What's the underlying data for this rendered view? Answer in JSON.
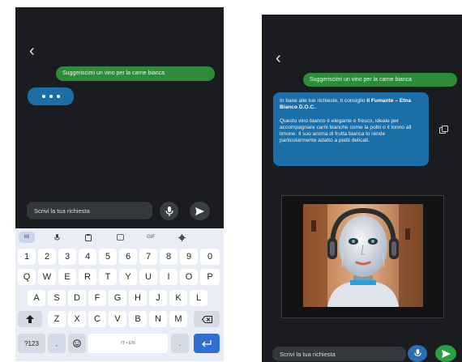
{
  "left_screen": {
    "back_glyph": "‹",
    "user_message": "Suggeriscimi un vino per la carne bianca",
    "input_placeholder": "Scrivi la tua richiesta",
    "keyboard": {
      "toolbar": [
        "88",
        "mic",
        "clipboard",
        "sticker",
        "GIF",
        "gear"
      ],
      "gif_label": "GIF",
      "apps_label": "88",
      "row_numbers": [
        "1",
        "2",
        "3",
        "4",
        "5",
        "6",
        "7",
        "8",
        "9",
        "0"
      ],
      "row_q": [
        "Q",
        "W",
        "E",
        "R",
        "T",
        "Y",
        "U",
        "I",
        "O",
        "P"
      ],
      "row_a": [
        "A",
        "S",
        "D",
        "F",
        "G",
        "H",
        "J",
        "K",
        "L"
      ],
      "row_z": [
        "Z",
        "X",
        "C",
        "V",
        "B",
        "N",
        "M"
      ],
      "symbols_label": "?123",
      "comma_label": ",",
      "space_label": "IT • EN",
      "period_label": "."
    }
  },
  "right_screen": {
    "back_glyph": "‹",
    "user_message": "Suggeriscimi un vino per la carne bianca",
    "bot_intro": "In base alle tue richieste, ti consiglio ",
    "bot_wine": "Il Fumante – Etna Bianco D.O.C.",
    "bot_intro_end": ".",
    "bot_body": "Questo vino bianco è elegante e fresco, ideale per accompagnare carni bianche come la pollo o il tonno all limone. Il suo aroma di frutta bianca lo rende particolarmente adatto a piatti delicati.",
    "input_placeholder": "Scrivi la tua richiesta"
  },
  "colors": {
    "screen_bg": "#1a1c1f",
    "user_bubble": "#2e8b3c",
    "bot_bubble": "#1c6ea8",
    "send_green": "#2e9e45",
    "keyboard_bg": "#e9eef6"
  },
  "icons": [
    "back-arrow-icon",
    "mic-icon",
    "send-icon",
    "copy-icon",
    "clipboard-icon",
    "sticker-icon",
    "gear-icon",
    "shift-icon",
    "backspace-icon",
    "emoji-icon",
    "enter-icon"
  ]
}
